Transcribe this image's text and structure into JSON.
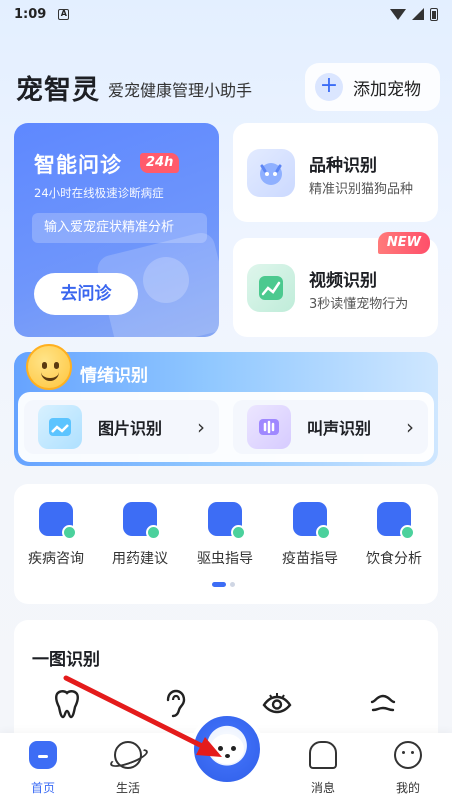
{
  "status": {
    "time": "1:09",
    "notif_glyph": "A"
  },
  "header": {
    "title": "宠智灵",
    "subtitle": "爱宠健康管理小助手",
    "add_pet_label": "添加宠物",
    "add_icon_glyph": "+"
  },
  "consult": {
    "title": "智能问诊",
    "badge": "24h",
    "subtitle": "24小时在线极速诊断病症",
    "hint": "输入爱宠症状精准分析",
    "button": "去问诊"
  },
  "features": [
    {
      "title": "品种识别",
      "subtitle": "精准识别猫狗品种",
      "icon": "cat-face-icon"
    },
    {
      "title": "视频识别",
      "subtitle": "3秒读懂宠物行为",
      "icon": "chart-line-icon",
      "tag": "NEW"
    }
  ],
  "emotion": {
    "title": "情绪识别",
    "image_label": "图片识别",
    "sound_label": "叫声识别",
    "chevron": "›"
  },
  "tools": [
    {
      "label": "疾病咨询",
      "icon": "chat-plus-icon"
    },
    {
      "label": "用药建议",
      "icon": "pill-calendar-icon"
    },
    {
      "label": "驱虫指导",
      "icon": "bottle-icon"
    },
    {
      "label": "疫苗指导",
      "icon": "vaccine-house-icon"
    },
    {
      "label": "饮食分析",
      "icon": "diet-chart-icon"
    }
  ],
  "one_pic": {
    "title": "一图识别",
    "icons": [
      "tooth-icon",
      "ear-icon",
      "eye-icon",
      "skin-icon"
    ]
  },
  "tabbar": {
    "home": "首页",
    "life": "生活",
    "messages": "消息",
    "me": "我的"
  },
  "colors": {
    "accent": "#3d6df5",
    "badge_red": "#ff5b6b",
    "arrow": "#e41b1b"
  }
}
